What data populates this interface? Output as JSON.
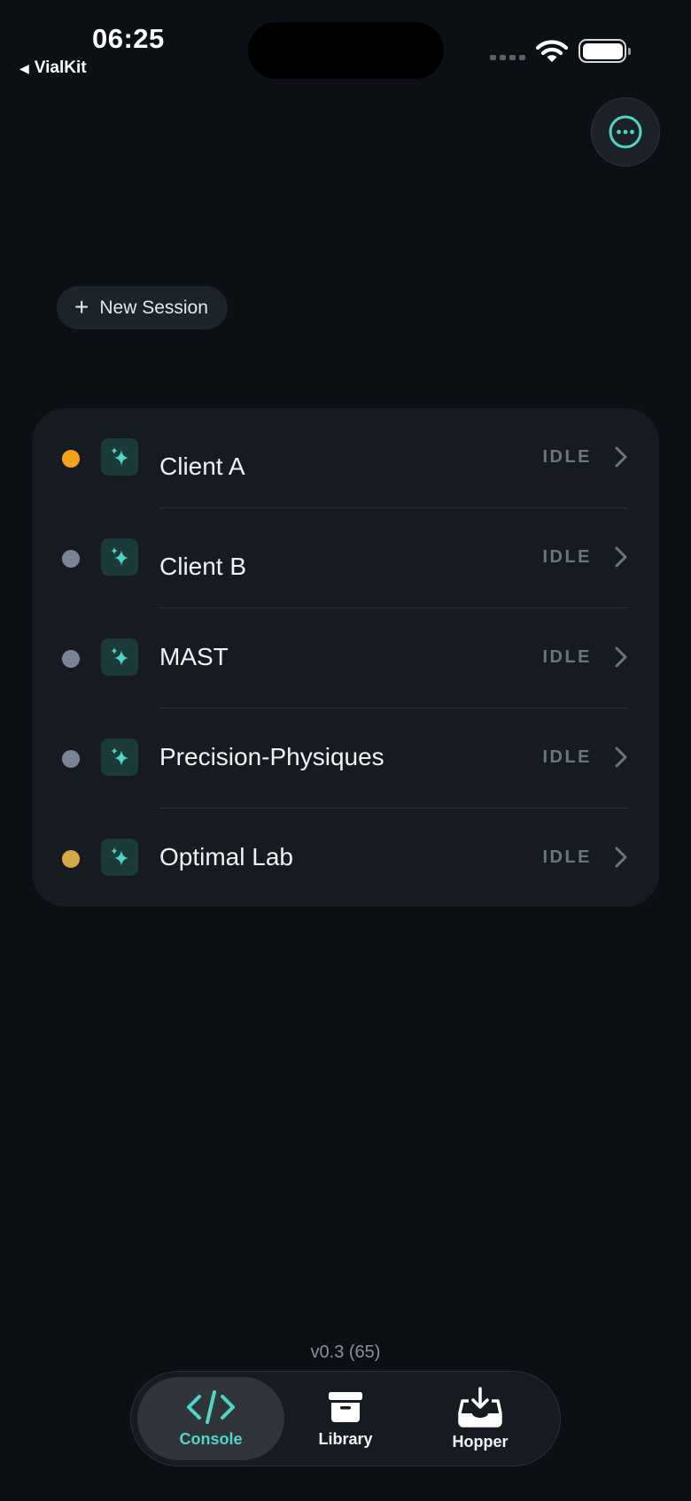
{
  "status_bar": {
    "time": "06:25",
    "back_app": "VialKit"
  },
  "toolbar": {
    "new_session_label": "New Session"
  },
  "sessions": [
    {
      "name": "Client A",
      "state": "IDLE",
      "dot_color": "#f5a11c"
    },
    {
      "name": "Client B",
      "state": "IDLE",
      "dot_color": "#7a8496"
    },
    {
      "name": "MAST",
      "state": "IDLE",
      "dot_color": "#7a8496"
    },
    {
      "name": "Precision-Physiques",
      "state": "IDLE",
      "dot_color": "#7a8496"
    },
    {
      "name": "Optimal Lab",
      "state": "IDLE",
      "dot_color": "#d6a84a"
    }
  ],
  "version": "v0.3 (65)",
  "tabs": [
    {
      "label": "Console",
      "icon": "code-icon",
      "active": true
    },
    {
      "label": "Library",
      "icon": "archive-box-icon",
      "active": false
    },
    {
      "label": "Hopper",
      "icon": "tray-download-icon",
      "active": false
    }
  ],
  "colors": {
    "accent": "#4fd6c6",
    "background": "#0c1014",
    "card": "#161b22"
  }
}
